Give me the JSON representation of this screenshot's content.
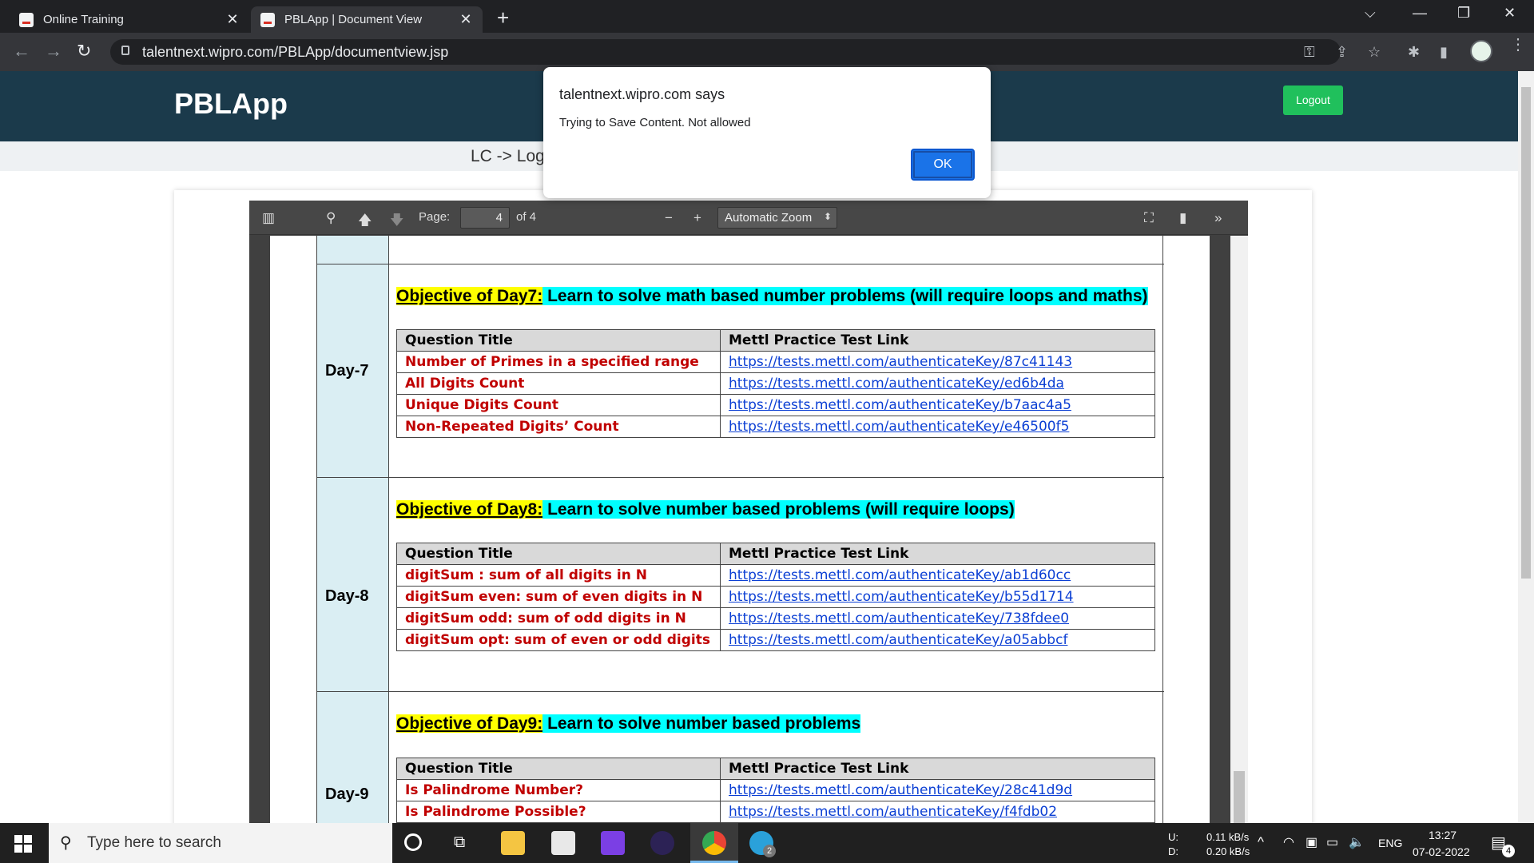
{
  "browser": {
    "tabs": [
      {
        "label": "Online Training"
      },
      {
        "label": "PBLApp | Document View"
      }
    ],
    "url": "talentnext.wipro.com/PBLApp/documentview.jsp"
  },
  "app": {
    "brand": "PBLApp",
    "logout_label": "Logout",
    "breadcrumb": "LC -> Log"
  },
  "dialog": {
    "title": "talentnext.wipro.com says",
    "message": "Trying to Save Content. Not allowed",
    "ok_label": "OK"
  },
  "pdf_toolbar": {
    "page_label": "Page:",
    "page_value": "4",
    "page_total": "of 4",
    "zoom": "Automatic Zoom"
  },
  "document": {
    "col_question": "Question Title",
    "col_link": "Mettl Practice Test Link",
    "days": [
      {
        "label": "Day-7",
        "objective_prefix": "Objective of Day7:",
        "objective_text": " Learn to solve math based number problems (will require loops and maths)",
        "rows": [
          {
            "q": "Number of Primes in a specified range",
            "link": "https://tests.mettl.com/authenticateKey/87c41143"
          },
          {
            "q": "All Digits Count",
            "link": "https://tests.mettl.com/authenticateKey/ed6b4da"
          },
          {
            "q": "Unique Digits Count",
            "link": "https://tests.mettl.com/authenticateKey/b7aac4a5"
          },
          {
            "q": "Non-Repeated Digits’ Count",
            "link": "https://tests.mettl.com/authenticateKey/e46500f5"
          }
        ]
      },
      {
        "label": "Day-8",
        "objective_prefix": "Objective of Day8:",
        "objective_text": " Learn to solve number based problems (will require loops)",
        "rows": [
          {
            "q": "digitSum : sum of all digits in N",
            "link": "https://tests.mettl.com/authenticateKey/ab1d60cc"
          },
          {
            "q": "digitSum even: sum of even digits in N",
            "link": "https://tests.mettl.com/authenticateKey/b55d1714"
          },
          {
            "q": "digitSum odd: sum of odd digits in N",
            "link": "https://tests.mettl.com/authenticateKey/738fdee0"
          },
          {
            "q": "digitSum opt: sum of even or odd digits",
            "link": "https://tests.mettl.com/authenticateKey/a05abbcf"
          }
        ]
      },
      {
        "label": "Day-9",
        "objective_prefix": "Objective of Day9:",
        "objective_text": " Learn to solve number based problems",
        "rows": [
          {
            "q": "Is Palindrome Number?",
            "link": "https://tests.mettl.com/authenticateKey/28c41d9d"
          },
          {
            "q": "Is Palindrome Possible?",
            "link": "https://tests.mettl.com/authenticateKey/f4fdb02"
          }
        ]
      }
    ]
  },
  "taskbar": {
    "search_placeholder": "Type here to search",
    "net_up_label": "U:",
    "net_down_label": "D:",
    "net_up": "0.11 kB/s",
    "net_down": "0.20 kB/s",
    "lang": "ENG",
    "time": "13:27",
    "date": "07-02-2022",
    "notif_count": "4",
    "telegram_badge": "2"
  },
  "icons": {
    "accent": "#1a73e8",
    "logout_green": "#20c05c",
    "appbar": "#1b3a4b"
  }
}
